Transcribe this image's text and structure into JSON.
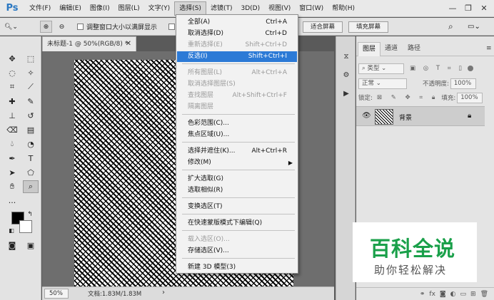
{
  "app": {
    "logo": "Ps"
  },
  "menubar": {
    "items": [
      "文件(F)",
      "编辑(E)",
      "图像(I)",
      "图层(L)",
      "文字(Y)",
      "选择(S)",
      "滤镜(T)",
      "3D(D)",
      "视图(V)",
      "窗口(W)",
      "帮助(H)"
    ],
    "active": "选择(S)"
  },
  "optbar": {
    "resize_windows_label": "调整窗口大小以满屏显示",
    "fit_screen": "适合屏幕",
    "fill_screen": "填充屏幕"
  },
  "document": {
    "tab_title": "未标题-1 @ 50%(RGB/8) *",
    "zoom": "50%",
    "doc_size": "文档:1.83M/1.83M"
  },
  "select_menu": {
    "items": [
      {
        "label": "全部(A)",
        "shortcut": "Ctrl+A",
        "disabled": false
      },
      {
        "label": "取消选择(D)",
        "shortcut": "Ctrl+D",
        "disabled": false
      },
      {
        "label": "重新选择(E)",
        "shortcut": "Shift+Ctrl+D",
        "disabled": true
      },
      {
        "label": "反选(I)",
        "shortcut": "Shift+Ctrl+I",
        "disabled": false,
        "highlighted": true
      },
      {
        "label": "所有图层(L)",
        "shortcut": "Alt+Ctrl+A",
        "disabled": true
      },
      {
        "label": "取消选择图层(S)",
        "shortcut": "",
        "disabled": true
      },
      {
        "label": "查找图层",
        "shortcut": "Alt+Shift+Ctrl+F",
        "disabled": true
      },
      {
        "label": "隔离图层",
        "shortcut": "",
        "disabled": true
      },
      {
        "label": "色彩范围(C)...",
        "shortcut": "",
        "disabled": false
      },
      {
        "label": "焦点区域(U)...",
        "shortcut": "",
        "disabled": false
      },
      {
        "label": "选择并遮住(K)...",
        "shortcut": "Alt+Ctrl+R",
        "disabled": false
      },
      {
        "label": "修改(M)",
        "shortcut": "",
        "disabled": false,
        "submenu": true
      },
      {
        "label": "扩大选取(G)",
        "shortcut": "",
        "disabled": false
      },
      {
        "label": "选取相似(R)",
        "shortcut": "",
        "disabled": false
      },
      {
        "label": "变换选区(T)",
        "shortcut": "",
        "disabled": false
      },
      {
        "label": "在快速蒙版模式下编辑(Q)",
        "shortcut": "",
        "disabled": false
      },
      {
        "label": "载入选区(O)...",
        "shortcut": "",
        "disabled": true
      },
      {
        "label": "存储选区(V)...",
        "shortcut": "",
        "disabled": false
      },
      {
        "label": "新建 3D 模型(3)",
        "shortcut": "",
        "disabled": false
      }
    ],
    "colors": {
      "highlight": "#2c7ad6"
    }
  },
  "layers_panel": {
    "tabs": [
      "图层",
      "通道",
      "路径"
    ],
    "filter_kind": "类型",
    "blend_mode": "正常",
    "opacity_label": "不透明度:",
    "opacity_value": "100%",
    "lock_label": "锁定:",
    "fill_label": "填充:",
    "fill_value": "100%",
    "layer_name": "背景"
  },
  "watermark": {
    "title": "百科全说",
    "subtitle": "助你轻松解决",
    "color": "#1aa04a"
  }
}
